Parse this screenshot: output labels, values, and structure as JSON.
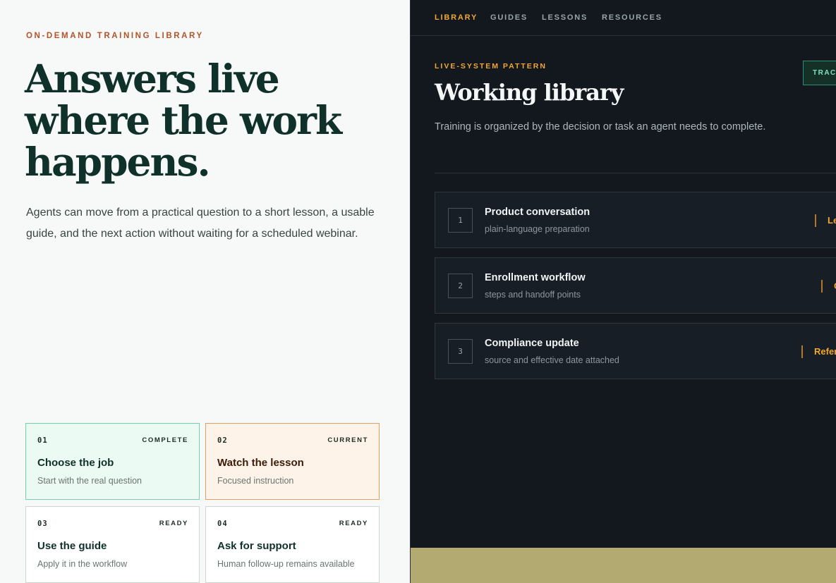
{
  "hero": {
    "eyebrow": "ON-DEMAND TRAINING LIBRARY",
    "headline": "Answers live where the work happens.",
    "lede": "Agents can move from a practical question to a short lesson, a usable guide, and the next action without waiting for a scheduled webinar."
  },
  "steps": [
    {
      "num": "01",
      "status": "COMPLETE",
      "title": "Choose the job",
      "sub": "Start with the real question"
    },
    {
      "num": "02",
      "status": "CURRENT",
      "title": "Watch the lesson",
      "sub": "Focused instruction"
    },
    {
      "num": "03",
      "status": "READY",
      "title": "Use the guide",
      "sub": "Apply it in the workflow"
    },
    {
      "num": "04",
      "status": "READY",
      "title": "Ask for support",
      "sub": "Human follow-up remains available"
    }
  ],
  "nav": {
    "items": [
      {
        "label": "LIBRARY",
        "active": true
      },
      {
        "label": "GUIDES",
        "active": false
      },
      {
        "label": "LESSONS",
        "active": false
      },
      {
        "label": "RESOURCES",
        "active": false
      }
    ]
  },
  "panel": {
    "pattern_label": "LIVE-SYSTEM PATTERN",
    "badge": "TRAC",
    "title": "Working library",
    "description": "Training is organized by the decision or task an agent needs to complete."
  },
  "library_rows": [
    {
      "num": "1",
      "title": "Product conversation",
      "sub": "plain-language preparation",
      "action": "Le"
    },
    {
      "num": "2",
      "title": "Enrollment workflow",
      "sub": "steps and handoff points",
      "action": "G"
    },
    {
      "num": "3",
      "title": "Compliance update",
      "sub": "source and effective date attached",
      "action": "Refer"
    }
  ],
  "colors": {
    "accent_orange": "#f2a734",
    "eyebrow_rust": "#b4532a",
    "headline_green": "#10302a",
    "complete_mint": "#6fd3b3",
    "current_amber": "#e0a062",
    "dark_panel": "#12181e",
    "footer_olive": "#b3aa72"
  }
}
